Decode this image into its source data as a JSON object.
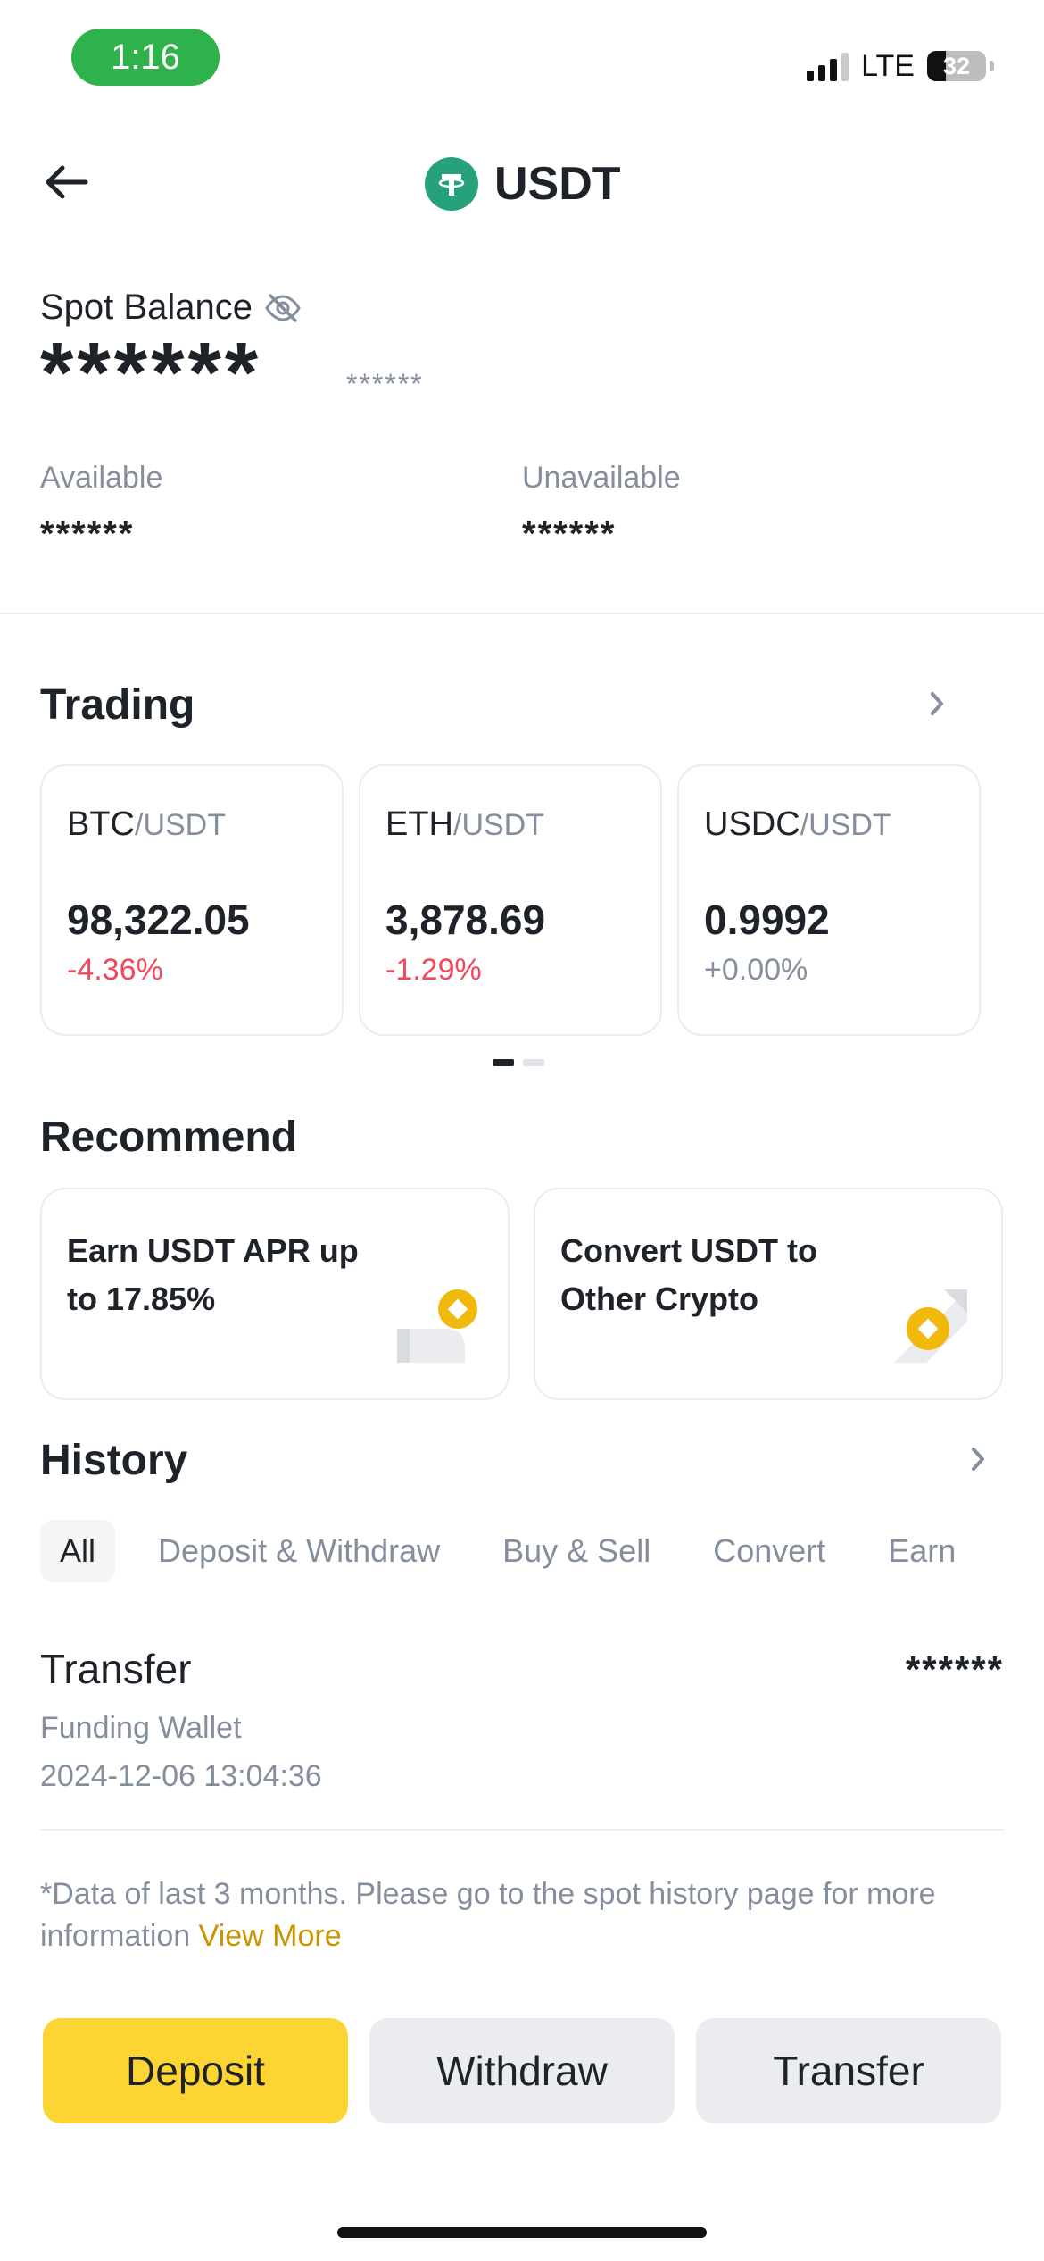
{
  "status_bar": {
    "time": "1:16",
    "network": "LTE",
    "battery": "32"
  },
  "header": {
    "title": "USDT",
    "coin_icon": "tether-icon",
    "back_icon": "arrow-left-icon"
  },
  "balance": {
    "label": "Spot Balance",
    "value": "******",
    "sub_value": "******",
    "available_label": "Available",
    "available_value": "******",
    "unavailable_label": "Unavailable",
    "unavailable_value": "******"
  },
  "trading": {
    "title": "Trading",
    "pairs": [
      {
        "base": "BTC",
        "quote": "/USDT",
        "price": "98,322.05",
        "change": "-4.36%"
      },
      {
        "base": "ETH",
        "quote": "/USDT",
        "price": "3,878.69",
        "change": "-1.29%"
      },
      {
        "base": "USDC",
        "quote": "/USDT",
        "price": "0.9992",
        "change": "+0.00%"
      }
    ]
  },
  "recommend": {
    "title": "Recommend",
    "cards": [
      {
        "text": "Earn USDT APR up to 17.85%"
      },
      {
        "text": "Convert USDT to Other Crypto"
      }
    ]
  },
  "history": {
    "title": "History",
    "tabs": [
      "All",
      "Deposit & Withdraw",
      "Buy & Sell",
      "Convert",
      "Earn"
    ],
    "items": [
      {
        "title": "Transfer",
        "subtitle": "Funding Wallet",
        "date": "2024-12-06 13:04:36",
        "amount": "******"
      }
    ],
    "note": "*Data of last 3 months. Please go to the spot history page for more information",
    "note_link": "View More"
  },
  "actions": {
    "deposit": "Deposit",
    "withdraw": "Withdraw",
    "transfer": "Transfer"
  },
  "colors": {
    "brand_yellow": "#fcd535",
    "negative": "#f6465d",
    "tether_green": "#26a17b",
    "link": "#c99400"
  }
}
